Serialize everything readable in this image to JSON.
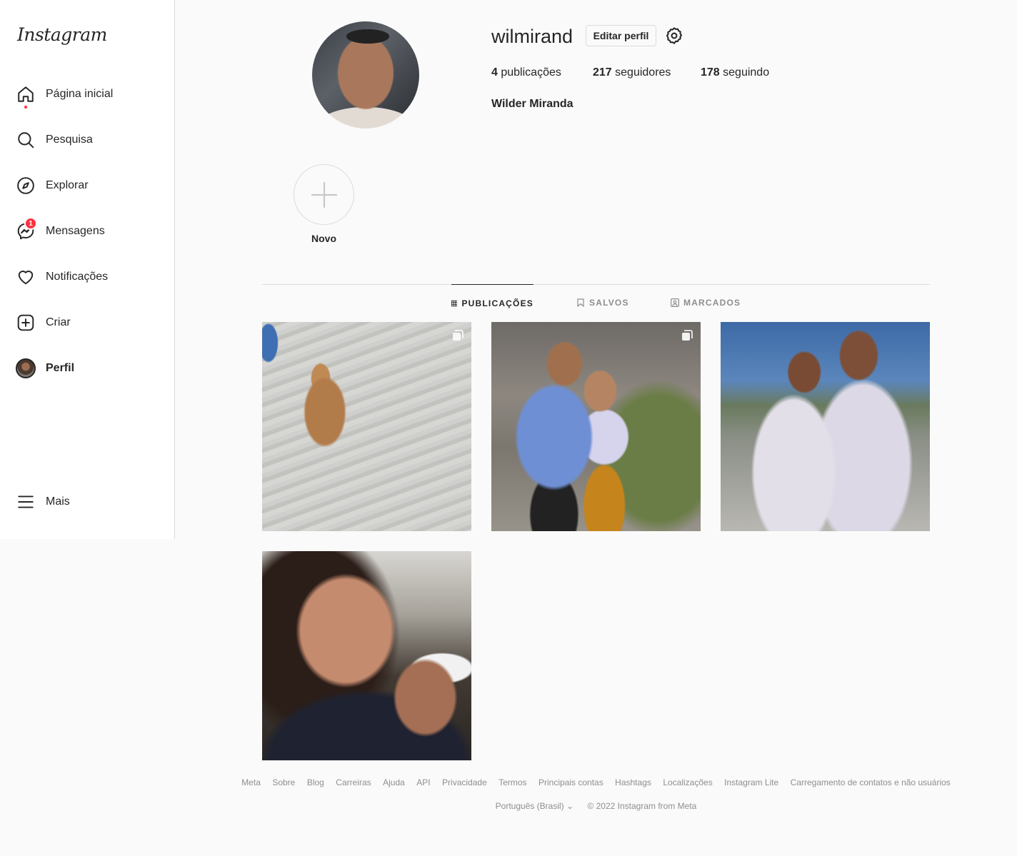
{
  "app": {
    "logo": "Instagram"
  },
  "sidebar": {
    "items": [
      {
        "label": "Página inicial"
      },
      {
        "label": "Pesquisa"
      },
      {
        "label": "Explorar"
      },
      {
        "label": "Mensagens",
        "badge": "1"
      },
      {
        "label": "Notificações"
      },
      {
        "label": "Criar"
      },
      {
        "label": "Perfil"
      }
    ],
    "more": "Mais"
  },
  "profile": {
    "username": "wilmirand",
    "edit_label": "Editar perfil",
    "posts_count": "4",
    "posts_label": "publicações",
    "followers_count": "217",
    "followers_label": "seguidores",
    "following_count": "178",
    "following_label": "seguindo",
    "full_name": "Wilder Miranda"
  },
  "highlights": {
    "new_label": "Novo"
  },
  "tabs": [
    {
      "label": "PUBLICAÇÕES",
      "active": true
    },
    {
      "label": "SALVOS",
      "active": false
    },
    {
      "label": "MARCADOS",
      "active": false
    }
  ],
  "footer": {
    "links": [
      "Meta",
      "Sobre",
      "Blog",
      "Carreiras",
      "Ajuda",
      "API",
      "Privacidade",
      "Termos",
      "Principais contas",
      "Hashtags",
      "Localizações",
      "Instagram Lite",
      "Carregamento de contatos e não usuários"
    ],
    "language": "Português (Brasil)",
    "copyright": "© 2022 Instagram from Meta"
  },
  "colors": {
    "badge": "#ff3040",
    "border": "#dbdbdb",
    "text": "#262626",
    "muted": "#8e8e8e"
  }
}
